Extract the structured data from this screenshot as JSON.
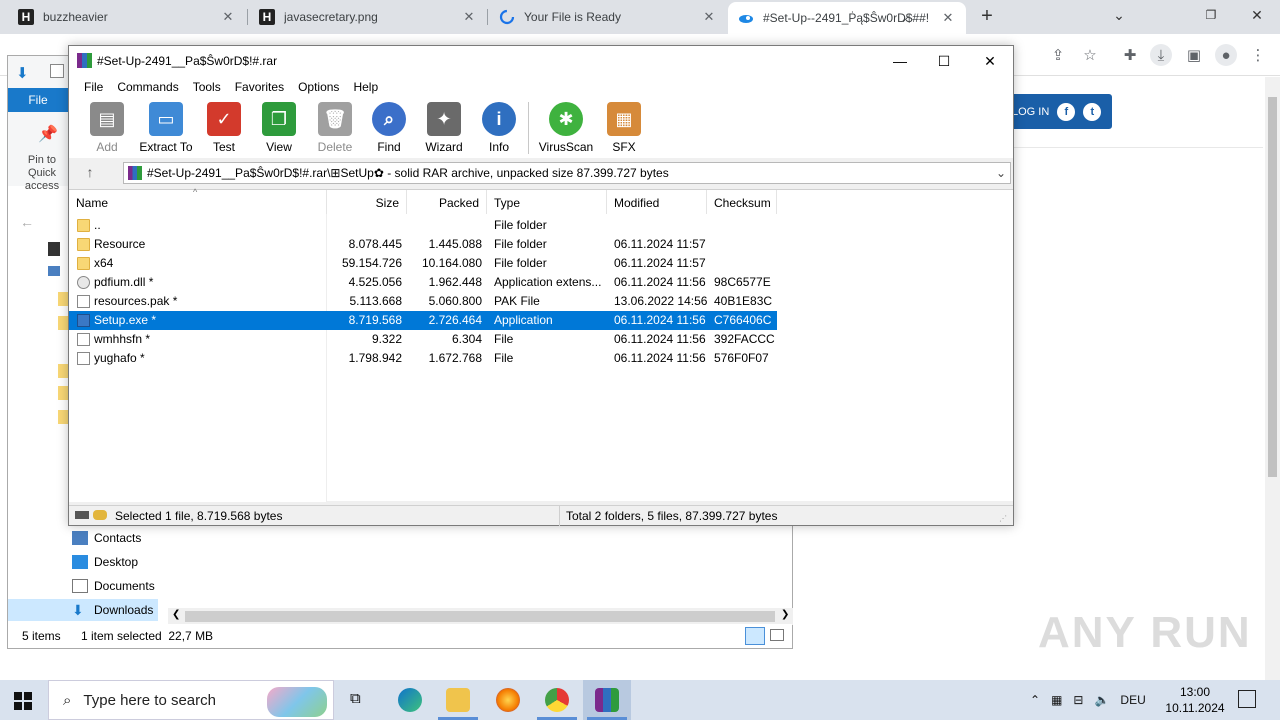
{
  "browser": {
    "tabs": [
      {
        "title": "buzzheavier",
        "fav": "H"
      },
      {
        "title": "javasecretary.png",
        "fav": "H"
      },
      {
        "title": "Your File is Ready",
        "fav": "loading"
      },
      {
        "title": "#Set-Up--2491_Ṗą$Ŝw0rD̷$##!",
        "fav": "cloud"
      }
    ],
    "new_tab": "+",
    "login_label": "LOG IN",
    "watermark": "ANY RUN"
  },
  "explorer": {
    "file_tab": "File",
    "pin_label": "Pin to Quick access",
    "nav": [
      {
        "label": "Contacts"
      },
      {
        "label": "Desktop"
      },
      {
        "label": "Documents"
      },
      {
        "label": "Downloads"
      }
    ],
    "status_items": "5 items",
    "status_selected": "1 item selected  22,7 MB"
  },
  "winrar": {
    "title": "#Set-Up-2491__Pa$Ŝw0rD$!#.rar",
    "menu": [
      "File",
      "Commands",
      "Tools",
      "Favorites",
      "Options",
      "Help"
    ],
    "toolbar": [
      {
        "label": "Add",
        "icon": "add-icon",
        "color": "#7a7a7a",
        "disabled": true
      },
      {
        "label": "Extract To",
        "icon": "extract-folder-icon",
        "color": "#3f8ad6"
      },
      {
        "label": "Test",
        "icon": "test-clipboard-icon",
        "color": "#d33a2c"
      },
      {
        "label": "View",
        "icon": "view-book-icon",
        "color": "#2e9b3c"
      },
      {
        "label": "Delete",
        "icon": "delete-bin-icon",
        "color": "#9a9a9a",
        "disabled": true
      },
      {
        "label": "Find",
        "icon": "find-magnifier-icon",
        "color": "#3b6fc9"
      },
      {
        "label": "Wizard",
        "icon": "wizard-wand-icon",
        "color": "#6a6a6a"
      },
      {
        "label": "Info",
        "icon": "info-icon",
        "color": "#2f6fc0"
      },
      {
        "label": "VirusScan",
        "icon": "virus-scan-icon",
        "color": "#3fb23f"
      },
      {
        "label": "SFX",
        "icon": "sfx-box-icon",
        "color": "#d68a3a"
      }
    ],
    "address": "#Set-Up-2491__Pa$Ŝw0rD$!#.rar\\⊞SetUp✿ - solid RAR archive, unpacked size 87.399.727 bytes",
    "columns": [
      "Name",
      "Size",
      "Packed",
      "Type",
      "Modified",
      "Checksum"
    ],
    "files": [
      {
        "name": "..",
        "size": "",
        "packed": "",
        "type": "File folder",
        "modified": "",
        "checksum": "",
        "icon": "folder"
      },
      {
        "name": "Resource",
        "size": "8.078.445",
        "packed": "1.445.088",
        "type": "File folder",
        "modified": "06.11.2024 11:57",
        "checksum": "",
        "icon": "folder"
      },
      {
        "name": "x64",
        "size": "59.154.726",
        "packed": "10.164.080",
        "type": "File folder",
        "modified": "06.11.2024 11:57",
        "checksum": "",
        "icon": "folder"
      },
      {
        "name": "pdfium.dll *",
        "size": "4.525.056",
        "packed": "1.962.448",
        "type": "Application extens...",
        "modified": "06.11.2024 11:56",
        "checksum": "98C6577E",
        "icon": "gear"
      },
      {
        "name": "resources.pak *",
        "size": "5.113.668",
        "packed": "5.060.800",
        "type": "PAK File",
        "modified": "13.06.2022 14:56",
        "checksum": "40B1E83C",
        "icon": "doc"
      },
      {
        "name": "Setup.exe *",
        "size": "8.719.568",
        "packed": "2.726.464",
        "type": "Application",
        "modified": "06.11.2024 11:56",
        "checksum": "C766406C",
        "icon": "app",
        "selected": true
      },
      {
        "name": "wmhhsfn *",
        "size": "9.322",
        "packed": "6.304",
        "type": "File",
        "modified": "06.11.2024 11:56",
        "checksum": "392FACCC",
        "icon": "doc"
      },
      {
        "name": "yughafo *",
        "size": "1.798.942",
        "packed": "1.672.768",
        "type": "File",
        "modified": "06.11.2024 11:56",
        "checksum": "576F0F07",
        "icon": "doc"
      }
    ],
    "status_left": "Selected 1 file, 8.719.568 bytes",
    "status_right": "Total 2 folders, 5 files, 87.399.727 bytes"
  },
  "taskbar": {
    "search_placeholder": "Type here to search",
    "language": "DEU",
    "time": "13:00",
    "date": "10.11.2024"
  }
}
